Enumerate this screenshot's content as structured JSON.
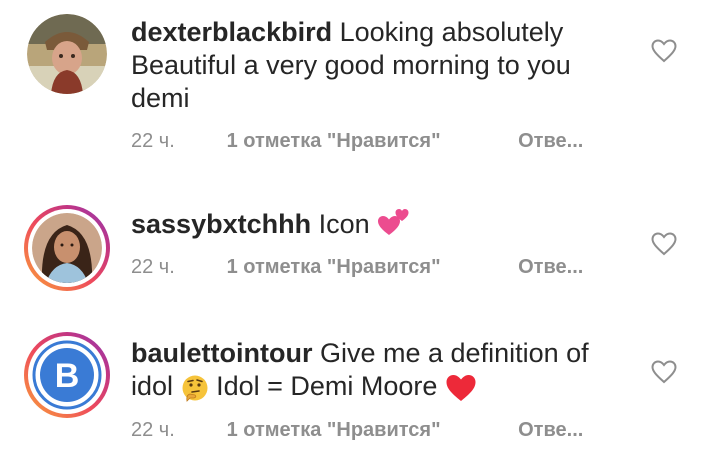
{
  "comments": [
    {
      "username": "dexterblackbird",
      "text": "Looking absolutely Beautiful a very good morning to you demi",
      "time": "22 ч.",
      "likes": "1 отметка \"Нравится\"",
      "reply": "Отве...",
      "avatar_icon": "user-photo",
      "story_ring": false
    },
    {
      "username": "sassybxtchhh",
      "text": "Icon",
      "emoji": "two-hearts-emoji",
      "time": "22 ч.",
      "likes": "1 отметка \"Нравится\"",
      "reply": "Отве...",
      "avatar_icon": "user-photo",
      "story_ring": true
    },
    {
      "username": "baulettointour",
      "text_part1": "Give me a definition of idol",
      "emoji1": "thinking-face-emoji",
      "text_part2": "Idol = Demi Moore",
      "emoji2": "red-heart-emoji",
      "avatar_letter": "B",
      "time": "22 ч.",
      "likes": "1 отметка \"Нравится\"",
      "reply": "Отве...",
      "story_ring": true
    }
  ],
  "colors": {
    "text": "#262626",
    "meta": "#8e8e8e",
    "accent_blue": "#3a7bd5",
    "heart_red": "#ed2939"
  }
}
